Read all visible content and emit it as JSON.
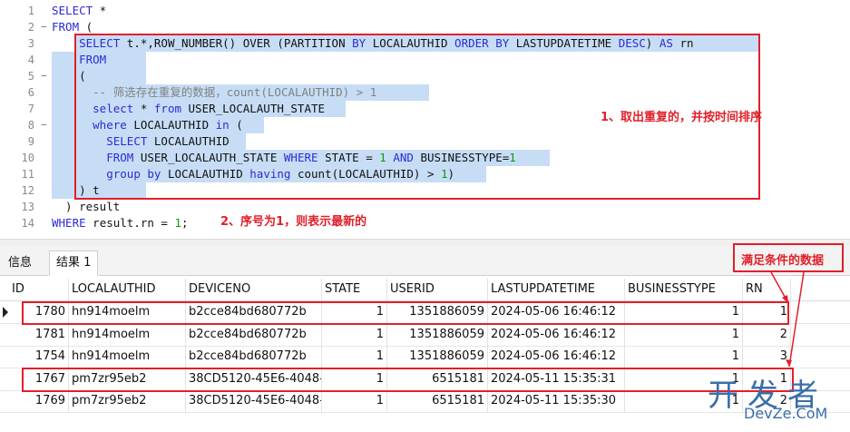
{
  "editor": {
    "lines": [
      {
        "n": "1",
        "fold": "",
        "parts": [
          {
            "t": "SELECT",
            "c": "kw"
          },
          {
            "t": " *",
            "c": "plain"
          }
        ]
      },
      {
        "n": "2",
        "fold": "−",
        "parts": [
          {
            "t": "FROM",
            "c": "kw"
          },
          {
            "t": " (",
            "c": "plain"
          }
        ]
      },
      {
        "n": "3",
        "fold": "",
        "parts": [
          {
            "t": "    ",
            "c": "plain"
          },
          {
            "t": "SELECT",
            "c": "kw"
          },
          {
            "t": " t.*,ROW_NUMBER() OVER (PARTITION ",
            "c": "plain"
          },
          {
            "t": "BY",
            "c": "kw"
          },
          {
            "t": " LOCALAUTHID ",
            "c": "plain"
          },
          {
            "t": "ORDER BY",
            "c": "kw"
          },
          {
            "t": " LASTUPDATETIME ",
            "c": "plain"
          },
          {
            "t": "DESC",
            "c": "kw"
          },
          {
            "t": ") ",
            "c": "plain"
          },
          {
            "t": "AS",
            "c": "kw"
          },
          {
            "t": " rn",
            "c": "plain"
          }
        ]
      },
      {
        "n": "4",
        "fold": "",
        "parts": [
          {
            "t": "    ",
            "c": "plain"
          },
          {
            "t": "FROM",
            "c": "kw"
          }
        ]
      },
      {
        "n": "5",
        "fold": "−",
        "parts": [
          {
            "t": "    (",
            "c": "plain"
          }
        ]
      },
      {
        "n": "6",
        "fold": "",
        "parts": [
          {
            "t": "      ",
            "c": "plain"
          },
          {
            "t": "-- 筛选存在重复的数据，count(LOCALAUTHID) > 1",
            "c": "cmt"
          }
        ]
      },
      {
        "n": "7",
        "fold": "",
        "parts": [
          {
            "t": "      ",
            "c": "plain"
          },
          {
            "t": "select",
            "c": "kw"
          },
          {
            "t": " * ",
            "c": "plain"
          },
          {
            "t": "from",
            "c": "kw"
          },
          {
            "t": " USER_LOCALAUTH_STATE",
            "c": "plain"
          }
        ]
      },
      {
        "n": "8",
        "fold": "−",
        "parts": [
          {
            "t": "      ",
            "c": "plain"
          },
          {
            "t": "where",
            "c": "kw"
          },
          {
            "t": " LOCALAUTHID ",
            "c": "plain"
          },
          {
            "t": "in",
            "c": "kw"
          },
          {
            "t": " (",
            "c": "plain"
          }
        ]
      },
      {
        "n": "9",
        "fold": "",
        "parts": [
          {
            "t": "        ",
            "c": "plain"
          },
          {
            "t": "SELECT",
            "c": "kw"
          },
          {
            "t": " LOCALAUTHID",
            "c": "plain"
          }
        ]
      },
      {
        "n": "10",
        "fold": "",
        "parts": [
          {
            "t": "        ",
            "c": "plain"
          },
          {
            "t": "FROM",
            "c": "kw"
          },
          {
            "t": " USER_LOCALAUTH_STATE ",
            "c": "plain"
          },
          {
            "t": "WHERE",
            "c": "kw"
          },
          {
            "t": " STATE = ",
            "c": "plain"
          },
          {
            "t": "1",
            "c": "num"
          },
          {
            "t": " ",
            "c": "plain"
          },
          {
            "t": "AND",
            "c": "kw"
          },
          {
            "t": " BUSINESSTYPE=",
            "c": "plain"
          },
          {
            "t": "1",
            "c": "num"
          }
        ]
      },
      {
        "n": "11",
        "fold": "",
        "parts": [
          {
            "t": "        ",
            "c": "plain"
          },
          {
            "t": "group by",
            "c": "kw"
          },
          {
            "t": " LOCALAUTHID ",
            "c": "plain"
          },
          {
            "t": "having",
            "c": "kw"
          },
          {
            "t": " count(LOCALAUTHID) > ",
            "c": "plain"
          },
          {
            "t": "1",
            "c": "num"
          },
          {
            "t": ")",
            "c": "plain"
          }
        ]
      },
      {
        "n": "12",
        "fold": "",
        "parts": [
          {
            "t": "    ) t",
            "c": "plain"
          }
        ]
      },
      {
        "n": "13",
        "fold": "",
        "parts": [
          {
            "t": "  ) result",
            "c": "plain"
          }
        ]
      },
      {
        "n": "14",
        "fold": "",
        "parts": [
          {
            "t": "WHERE",
            "c": "kw"
          },
          {
            "t": " result.rn = ",
            "c": "plain"
          },
          {
            "t": "1",
            "c": "num"
          },
          {
            "t": ";",
            "c": "plain"
          }
        ]
      }
    ]
  },
  "annotations": {
    "a1": "1、取出重复的，并按时间排序",
    "a2": "2、序号为1，则表示最新的",
    "a3": "满足条件的数据"
  },
  "tabs": [
    "信息",
    "结果 1"
  ],
  "table": {
    "columns": [
      "ID",
      "LOCALAUTHID",
      "DEVICENO",
      "STATE",
      "USERID",
      "LASTUPDATETIME",
      "BUSINESSTYPE",
      "RN"
    ],
    "rows": [
      [
        "1780",
        "hn914moelm",
        "b2cce84bd680772b",
        "1",
        "1351886059",
        "2024-05-06 16:46:12",
        "1",
        "1"
      ],
      [
        "1781",
        "hn914moelm",
        "b2cce84bd680772b",
        "1",
        "1351886059",
        "2024-05-06 16:46:12",
        "1",
        "2"
      ],
      [
        "1754",
        "hn914moelm",
        "b2cce84bd680772b",
        "1",
        "1351886059",
        "2024-05-06 16:46:12",
        "1",
        "3"
      ],
      [
        "1767",
        "pm7zr95eb2",
        "38CD5120-45E6-4048-",
        "1",
        "6515181",
        "2024-05-11 15:35:31",
        "1",
        "1"
      ],
      [
        "1769",
        "pm7zr95eb2",
        "38CD5120-45E6-4048-",
        "1",
        "6515181",
        "2024-05-11 15:35:30",
        "1",
        "2"
      ]
    ]
  },
  "watermark": {
    "main": "开发者",
    "sub": "DevZe.CoM"
  },
  "colors": {
    "annotation_red": "#e0202a",
    "selection_blue": "#c7ddf5",
    "keyword_blue": "#2b2bd6"
  }
}
